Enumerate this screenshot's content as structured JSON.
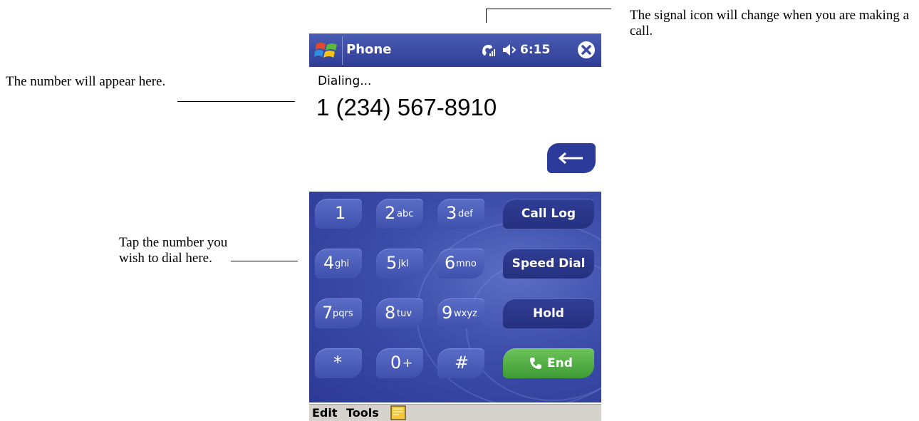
{
  "annotations": {
    "signal": "The signal icon will change when you are making a call.",
    "number": "The number will appear here.",
    "keypad": "Tap the number you wish to dial here."
  },
  "titlebar": {
    "app_title": "Phone",
    "time": "6:15"
  },
  "call": {
    "status": "Dialing...",
    "number": "1 (234) 567-8910"
  },
  "keypad": {
    "keys": [
      {
        "digit": "1",
        "letters": ""
      },
      {
        "digit": "2",
        "letters": "abc"
      },
      {
        "digit": "3",
        "letters": "def"
      },
      {
        "digit": "4",
        "letters": "ghi"
      },
      {
        "digit": "5",
        "letters": "jkl"
      },
      {
        "digit": "6",
        "letters": "mno"
      },
      {
        "digit": "7",
        "letters": "pqrs"
      },
      {
        "digit": "8",
        "letters": "tuv"
      },
      {
        "digit": "9",
        "letters": "wxyz"
      },
      {
        "digit": "*",
        "letters": ""
      },
      {
        "digit": "0",
        "letters": "+"
      },
      {
        "digit": "#",
        "letters": ""
      }
    ],
    "call_log": "Call Log",
    "speed_dial": "Speed Dial",
    "hold": "Hold",
    "end": "End"
  },
  "menubar": {
    "edit": "Edit",
    "tools": "Tools"
  },
  "colors": {
    "titlebar": "#3a4aa3",
    "keypad": "#3c4ca9",
    "end_key": "#4fae44",
    "menubar": "#d6d3ce"
  }
}
